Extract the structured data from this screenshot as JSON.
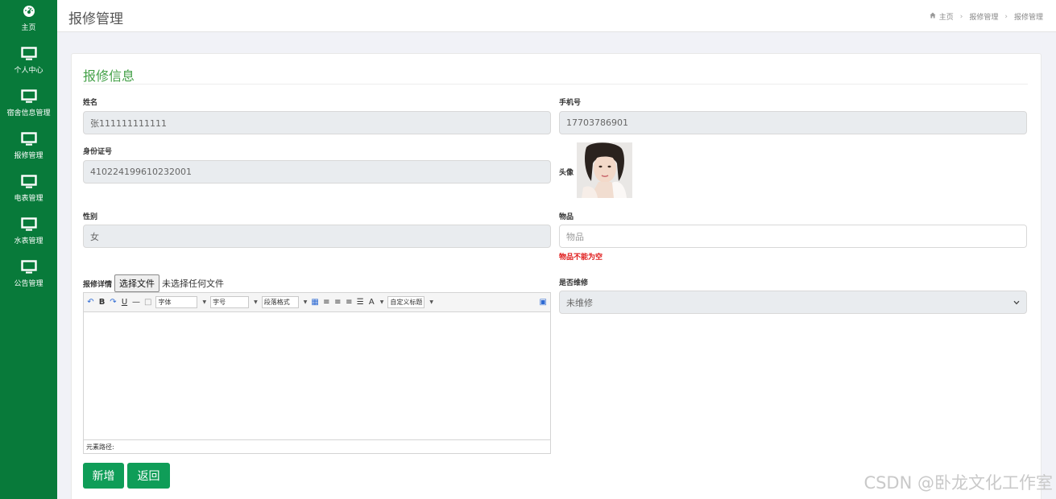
{
  "sidebar": {
    "items": [
      {
        "label": "主页",
        "icon": "dashboard-icon"
      },
      {
        "label": "个人中心",
        "icon": "monitor-icon"
      },
      {
        "label": "宿舍信息管理",
        "icon": "monitor-icon"
      },
      {
        "label": "报修管理",
        "icon": "monitor-icon"
      },
      {
        "label": "电表管理",
        "icon": "monitor-icon"
      },
      {
        "label": "水表管理",
        "icon": "monitor-icon"
      },
      {
        "label": "公告管理",
        "icon": "monitor-icon"
      }
    ]
  },
  "header": {
    "title": "报修管理",
    "breadcrumb": [
      "主页",
      "报修管理",
      "报修管理"
    ]
  },
  "form": {
    "section_title": "报修信息",
    "name": {
      "label": "姓名",
      "value": "张111111111111"
    },
    "phone": {
      "label": "手机号",
      "value": "17703786901"
    },
    "id_card": {
      "label": "身份证号",
      "value": "410224199610232001"
    },
    "avatar": {
      "label": "头像"
    },
    "gender": {
      "label": "性别",
      "value": "女"
    },
    "item": {
      "label": "物品",
      "placeholder": "物品",
      "error": "物品不能为空"
    },
    "details": {
      "label": "报修详情",
      "file_button": "选择文件",
      "file_status": "未选择任何文件"
    },
    "repaired": {
      "label": "是否维修",
      "value": "未维修"
    }
  },
  "editor": {
    "font_select": "字体",
    "size_select": "字号",
    "paragraph_select": "段落格式",
    "custom_title_select": "自定义标题",
    "status_path": "元素路径:"
  },
  "actions": {
    "add": "新增",
    "back": "返回"
  },
  "watermark": "CSDN @卧龙文化工作室",
  "colors": {
    "sidebar": "#087a3a",
    "accent": "#43a047",
    "button": "#0f9d58",
    "error": "#e01b1b"
  }
}
